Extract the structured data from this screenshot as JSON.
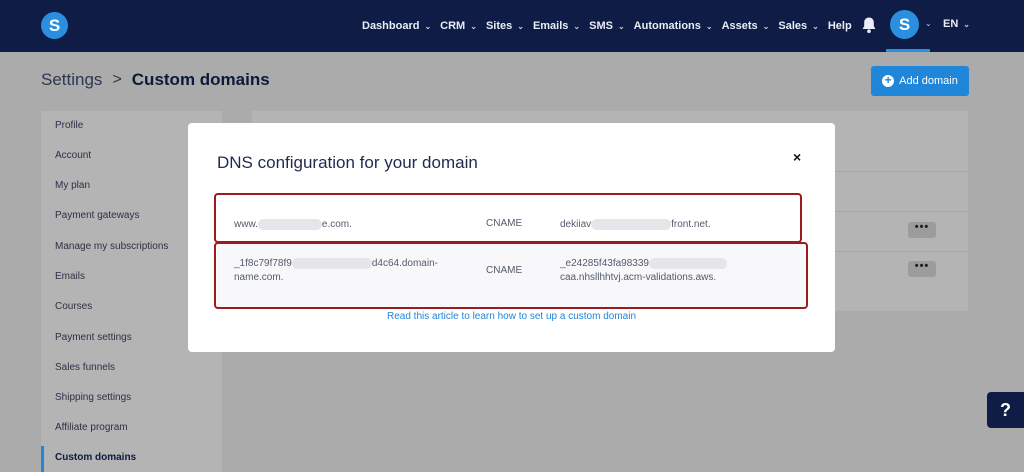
{
  "topbar": {
    "logo": "S",
    "nav": [
      "Dashboard",
      "CRM",
      "Sites",
      "Emails",
      "SMS",
      "Automations",
      "Assets",
      "Sales",
      "Help"
    ],
    "nav_has_dropdown": [
      true,
      true,
      true,
      true,
      true,
      true,
      true,
      true,
      false
    ],
    "avatar": "S",
    "language": "EN"
  },
  "header": {
    "breadcrumb_root": "Settings",
    "breadcrumb_sep": ">",
    "breadcrumb_current": "Custom domains",
    "add_button": "Add domain"
  },
  "sidebar": {
    "items": [
      "Profile",
      "Account",
      "My plan",
      "Payment gateways",
      "Manage my subscriptions",
      "Emails",
      "Courses",
      "Payment settings",
      "Sales funnels",
      "Shipping settings",
      "Affiliate program",
      "Custom domains"
    ],
    "active": "Custom domains"
  },
  "panel": {
    "more_label": "•••"
  },
  "modal": {
    "title": "DNS configuration for your domain",
    "close": "×",
    "records": [
      {
        "host_start": "www.",
        "host_end": "e.com.",
        "type": "CNAME",
        "value_start": "dekiiav",
        "value_end": "front.net."
      },
      {
        "host_start": "_1f8c79f78f9",
        "host_end": "d4c64.domain-name.com.",
        "type": "CNAME",
        "value_start": "_e24285f43fa98339",
        "value_end": "caa.nhsllhhtvj.acm-validations.aws."
      }
    ],
    "link": "Read this article to learn how to set up a custom domain"
  },
  "help_label": "?",
  "colors": {
    "navbar": "#0f1c45",
    "accent": "#1f86d9",
    "highlight": "#9b1c1c",
    "overlay": "#ababab"
  }
}
